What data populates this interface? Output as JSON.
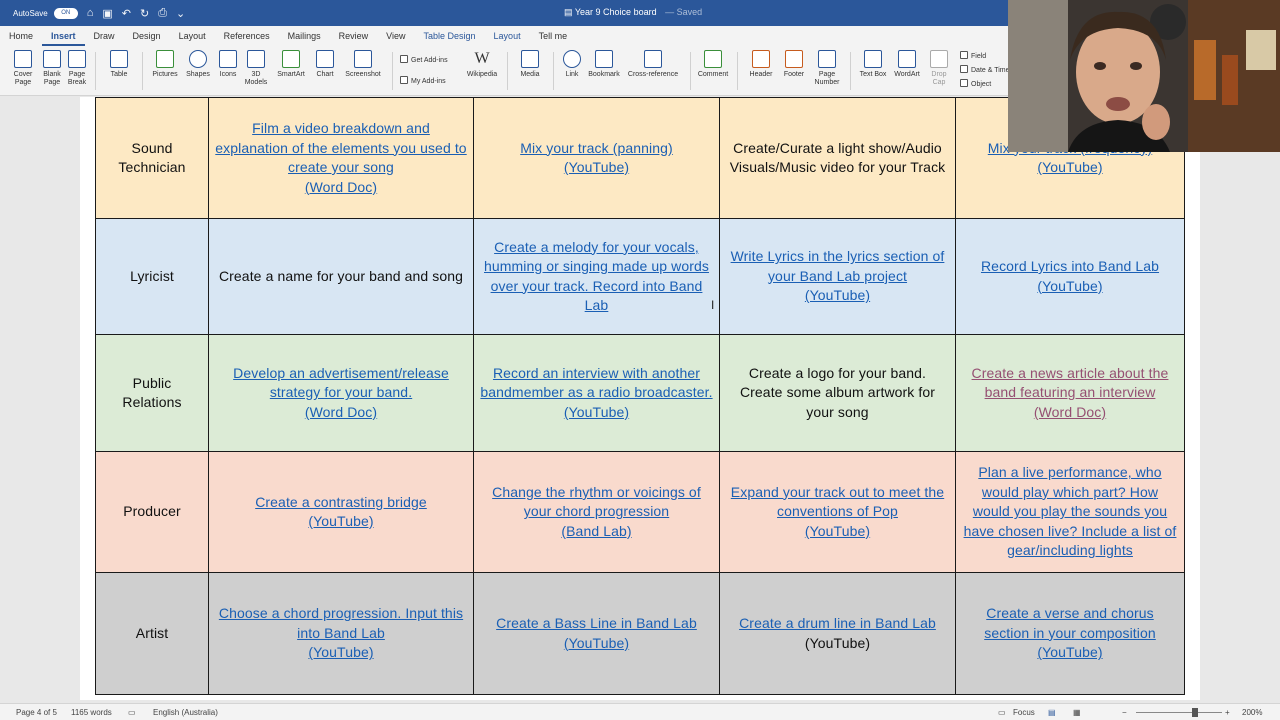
{
  "titlebar": {
    "autosave_label": "AutoSave",
    "autosave_state": "ON",
    "doc_title": "Year 9 Choice board",
    "save_status": "— Saved"
  },
  "tabs": [
    "Home",
    "Insert",
    "Draw",
    "Design",
    "Layout",
    "References",
    "Mailings",
    "Review",
    "View",
    "Table Design",
    "Layout",
    "Tell me"
  ],
  "active_tab": "Insert",
  "ribbon": {
    "cover_page": "Cover\nPage",
    "blank_page": "Blank\nPage",
    "page_break": "Page\nBreak",
    "table": "Table",
    "pictures": "Pictures",
    "shapes": "Shapes",
    "icons": "Icons",
    "models_3d": "3D\nModels",
    "smartart": "SmartArt",
    "chart": "Chart",
    "screenshot": "Screenshot",
    "get_addins": "Get Add-ins",
    "my_addins": "My Add-ins",
    "wikipedia": "Wikipedia",
    "media": "Media",
    "link": "Link",
    "bookmark": "Bookmark",
    "cross_reference": "Cross-reference",
    "comment": "Comment",
    "header": "Header",
    "footer": "Footer",
    "page_number": "Page\nNumber",
    "text_box": "Text Box",
    "wordart": "WordArt",
    "drop_cap": "Drop\nCap",
    "field": "Field",
    "date_time": "Date & Time",
    "object": "Object"
  },
  "rows": [
    {
      "role": "Sound\nTechnician",
      "cells": [
        {
          "text": "Film a video breakdown and explanation of the elements you used to create your song\n(Word Doc)",
          "link": true
        },
        {
          "text": "Mix your track (panning)\n(YouTube)",
          "link": true
        },
        {
          "text": "Create/Curate a light show/Audio Visuals/Music video for your Track",
          "link": false
        },
        {
          "text": "Mix your track (frequency)\n(YouTube)",
          "link": true
        }
      ]
    },
    {
      "role": "Lyricist",
      "cells": [
        {
          "text": "Create a name for your band and song",
          "link": false
        },
        {
          "text": "Create a melody for your vocals, humming or singing made up words over your track. Record into Band Lab",
          "link": true
        },
        {
          "text": "Write Lyrics in the lyrics section of your Band Lab project\n(YouTube)",
          "link": true
        },
        {
          "text": "Record Lyrics into Band Lab\n(YouTube)",
          "link": true
        }
      ]
    },
    {
      "role": "Public\nRelations",
      "cells": [
        {
          "text": "Develop an advertisement/release strategy for your band.\n(Word Doc)",
          "link": true
        },
        {
          "text": "Record an interview with another bandmember as a radio broadcaster.\n(YouTube)",
          "link": true
        },
        {
          "text": "Create a logo for your band. Create some album artwork for your song",
          "link": false
        },
        {
          "text": "Create a news article about the band featuring an interview\n(Word Doc)",
          "link": true,
          "visited": true
        }
      ]
    },
    {
      "role": "Producer",
      "cells": [
        {
          "text": "Create a contrasting bridge\n(YouTube)",
          "link": true
        },
        {
          "text": "Change the rhythm or voicings of your chord progression\n(Band Lab)",
          "link": true
        },
        {
          "text": "Expand your track out to meet the conventions of Pop\n(YouTube)",
          "link": true
        },
        {
          "text": "Plan a live performance, who would play which part? How would you play the sounds you have chosen live? Include a list of gear/including lights",
          "link": true
        }
      ]
    },
    {
      "role": "Artist",
      "cells": [
        {
          "text": "Choose a chord progression. Input this into Band Lab\n(YouTube)",
          "link": true
        },
        {
          "text": "Create a Bass Line in Band Lab\n(YouTube)",
          "link": true
        },
        {
          "text": "Create a drum line in Band Lab",
          "link": true,
          "suffix": "(YouTube)"
        },
        {
          "text": "Create a verse and chorus section in your composition\n(YouTube)",
          "link": true
        }
      ]
    }
  ],
  "statusbar": {
    "page": "Page 4 of 5",
    "words": "1165 words",
    "language": "English (Australia)",
    "focus": "Focus",
    "zoom": "200%"
  }
}
